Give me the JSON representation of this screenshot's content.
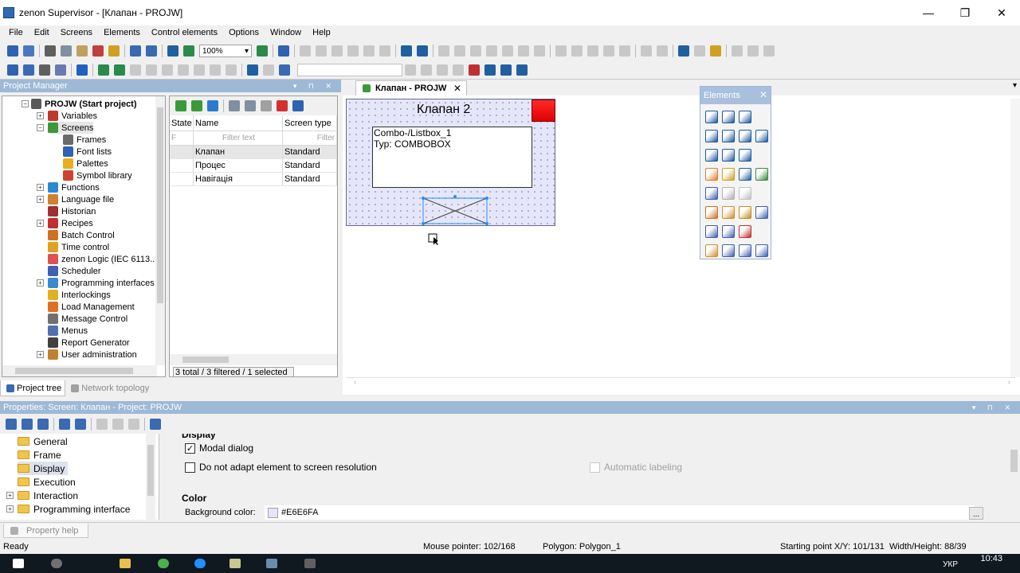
{
  "window": {
    "title": "zenon Supervisor - [Клапан - PROJW]",
    "min_glyph": "—",
    "restore_glyph": "❐",
    "close_glyph": "✕"
  },
  "menu": [
    "File",
    "Edit",
    "Screens",
    "Elements",
    "Control elements",
    "Options",
    "Window",
    "Help"
  ],
  "toolbar": {
    "zoom": "100%",
    "dropdown_glyph": "▾"
  },
  "project_manager": {
    "title": "Project Manager",
    "pin_glyphs": "▾ ⊓ ✕",
    "tree": [
      {
        "label": "PROJW (Start project)",
        "icon": "project-icon",
        "color": "#5a5a5a",
        "expander": "−"
      },
      {
        "label": "Variables",
        "icon": "variables-icon",
        "color": "#c0392b",
        "expander": "+"
      },
      {
        "label": "Screens",
        "icon": "screens-icon",
        "color": "#3a9a3a",
        "expander": "−"
      },
      {
        "label": "Frames",
        "icon": "frames-icon",
        "color": "#6a6a6a",
        "expander": ""
      },
      {
        "label": "Font lists",
        "icon": "fontlist-icon",
        "color": "#2f62b0",
        "expander": ""
      },
      {
        "label": "Palettes",
        "icon": "palette-icon",
        "color": "#e6b020",
        "expander": ""
      },
      {
        "label": "Symbol library",
        "icon": "symbol-library-icon",
        "color": "#d04030",
        "expander": ""
      },
      {
        "label": "Functions",
        "icon": "functions-icon",
        "color": "#2a8ad0",
        "expander": "+"
      },
      {
        "label": "Language file",
        "icon": "language-icon",
        "color": "#d08030",
        "expander": "+"
      },
      {
        "label": "Historian",
        "icon": "historian-icon",
        "color": "#a03030",
        "expander": ""
      },
      {
        "label": "Recipes",
        "icon": "recipes-icon",
        "color": "#c03030",
        "expander": "+"
      },
      {
        "label": "Batch Control",
        "icon": "batch-icon",
        "color": "#d07020",
        "expander": ""
      },
      {
        "label": "Time control",
        "icon": "time-icon",
        "color": "#e0a020",
        "expander": ""
      },
      {
        "label": "zenon Logic (IEC 6113...",
        "icon": "logic-icon",
        "color": "#e05050",
        "expander": ""
      },
      {
        "label": "Scheduler",
        "icon": "scheduler-icon",
        "color": "#4060b0",
        "expander": ""
      },
      {
        "label": "Programming interfaces",
        "icon": "programming-icon",
        "color": "#3a8ad0",
        "expander": "+"
      },
      {
        "label": "Interlockings",
        "icon": "lock-icon",
        "color": "#e0b020",
        "expander": ""
      },
      {
        "label": "Load Management",
        "icon": "load-icon",
        "color": "#e07020",
        "expander": ""
      },
      {
        "label": "Message Control",
        "icon": "message-icon",
        "color": "#707070",
        "expander": ""
      },
      {
        "label": "Menus",
        "icon": "menus-icon",
        "color": "#5070b0",
        "expander": ""
      },
      {
        "label": "Report Generator",
        "icon": "report-icon",
        "color": "#404040",
        "expander": ""
      },
      {
        "label": "User administration",
        "icon": "user-icon",
        "color": "#c08030",
        "expander": "+"
      }
    ],
    "screens_list": {
      "columns": [
        "State",
        "Name",
        "Screen type"
      ],
      "filter_placeholder": "Filter text",
      "filter_short": "F",
      "filter_short2": "Filter",
      "rows": [
        {
          "state": "",
          "name": "Клапан",
          "type": "Standard",
          "selected": true
        },
        {
          "state": "",
          "name": "Процес",
          "type": "Standard",
          "selected": false
        },
        {
          "state": "",
          "name": "Навігація",
          "type": "Standard",
          "selected": false
        }
      ],
      "status": "3 total / 3 filtered / 1 selected"
    },
    "tabs": [
      "Project tree",
      "Network topology"
    ]
  },
  "editor": {
    "tab_label": "Клапан - PROJW",
    "tab_close": "✕",
    "screen_title": "Клапан 2",
    "combo": {
      "line1": "Combo-/Listbox_1",
      "line2": "Typ: COMBOBOX"
    },
    "colors": {
      "canvas_bg": "#E6E6FA",
      "selection": "#1e90ff",
      "accent_red": "#ff0000"
    }
  },
  "elements_palette": {
    "title": "Elements",
    "close_glyph": "✕",
    "icons": [
      {
        "name": "pointer-icon",
        "color": "#1e5aa0"
      },
      {
        "name": "circle-icon",
        "color": "#1e5aa0"
      },
      {
        "name": "arc-icon",
        "color": "#1e5aa0"
      },
      {
        "name": "blank",
        "color": ""
      },
      {
        "name": "pie-icon",
        "color": "#1e5aa0"
      },
      {
        "name": "line-icon",
        "color": "#1e5aa0"
      },
      {
        "name": "polygon-icon",
        "color": "#1e5aa0"
      },
      {
        "name": "polyline-icon",
        "color": "#1e5aa0"
      },
      {
        "name": "rectangle-icon",
        "color": "#1e5aa0"
      },
      {
        "name": "step-line-icon",
        "color": "#1e5aa0"
      },
      {
        "name": "text-icon",
        "color": "#1e5aa0"
      },
      {
        "name": "blank",
        "color": ""
      },
      {
        "name": "valve-icon",
        "color": "#e08030"
      },
      {
        "name": "arrow-icon",
        "color": "#d0a020"
      },
      {
        "name": "slider-icon",
        "color": "#2060a0"
      },
      {
        "name": "image-icon",
        "color": "#3a8a3a"
      },
      {
        "name": "list-icon",
        "color": "#4060b0"
      },
      {
        "name": "trend-icon",
        "color": "#b0b0b0"
      },
      {
        "name": "gauge-icon",
        "color": "#c0c0c0"
      },
      {
        "name": "blank",
        "color": ""
      },
      {
        "name": "numeric-icon",
        "color": "#d07020"
      },
      {
        "name": "note-icon",
        "color": "#d09030"
      },
      {
        "name": "diamond-icon",
        "color": "#c09020"
      },
      {
        "name": "display-icon",
        "color": "#4060b0"
      },
      {
        "name": "chart-icon",
        "color": "#4060b0"
      },
      {
        "name": "mpf-icon",
        "color": "#4060b0"
      },
      {
        "name": "cross-icon",
        "color": "#c03030"
      },
      {
        "name": "blank",
        "color": ""
      },
      {
        "name": "combo-icon",
        "color": "#d09030"
      },
      {
        "name": "table-icon",
        "color": "#4060b0"
      },
      {
        "name": "tooltip-icon",
        "color": "#4060b0"
      },
      {
        "name": "group-icon",
        "color": "#4060b0"
      }
    ]
  },
  "properties": {
    "title": "Properties: Screen: Клапан - Project: PROJW",
    "pin_glyphs": "▾ ⊓ ✕",
    "tree": [
      {
        "label": "General",
        "selected": false,
        "expander": ""
      },
      {
        "label": "Frame",
        "selected": false,
        "expander": ""
      },
      {
        "label": "Display",
        "selected": true,
        "expander": ""
      },
      {
        "label": "Execution",
        "selected": false,
        "expander": ""
      },
      {
        "label": "Interaction",
        "selected": false,
        "expander": "+"
      },
      {
        "label": "Programming interface",
        "selected": false,
        "expander": "+"
      }
    ],
    "section_display": "Display",
    "modal_dialog": {
      "label": "Modal dialog",
      "checked": "✓"
    },
    "no_adapt": {
      "label": "Do not adapt element to screen resolution",
      "checked": ""
    },
    "auto_label": {
      "label": "Automatic labeling"
    },
    "section_color": "Color",
    "bg_color_label": "Background color:",
    "bg_color_value": "#E6E6FA",
    "ellipsis": "...",
    "help_tab": "Property help"
  },
  "status": {
    "ready": "Ready",
    "pointer": "Mouse pointer: 102/168",
    "polygon": "Polygon: Polygon_1",
    "start": "Starting point X/Y: 101/131",
    "size": "Width/Height: 88/39"
  },
  "taskbar": {
    "time": "10:43",
    "lang": "УКР"
  }
}
